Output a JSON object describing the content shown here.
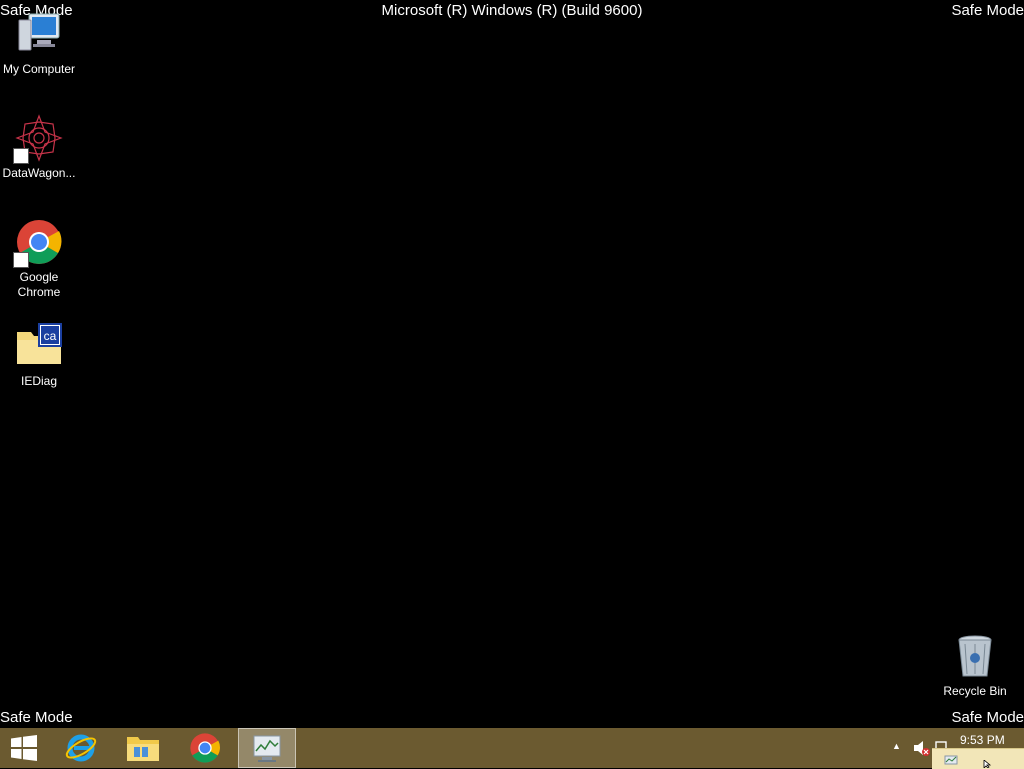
{
  "overlay": {
    "safe_mode": "Safe Mode",
    "build": "Microsoft (R) Windows (R) (Build 9600)"
  },
  "desktop": {
    "icons": [
      {
        "label": "My Computer",
        "icon": "computer-icon"
      },
      {
        "label": "DataWagon...",
        "icon": "datawagon-icon"
      },
      {
        "label": "Google\nChrome",
        "icon": "chrome-icon"
      },
      {
        "label": "IEDiag",
        "icon": "folder-icon"
      },
      {
        "label": "Recycle Bin",
        "icon": "recycle-bin-icon"
      }
    ]
  },
  "taskbar": {
    "color": "#6b5a30",
    "buttons": [
      {
        "icon": "windows-start-icon"
      },
      {
        "icon": "internet-explorer-icon"
      },
      {
        "icon": "file-explorer-icon"
      },
      {
        "icon": "chrome-icon"
      },
      {
        "icon": "performance-monitor-icon",
        "active": true
      }
    ],
    "clock": "9:53 PM"
  }
}
